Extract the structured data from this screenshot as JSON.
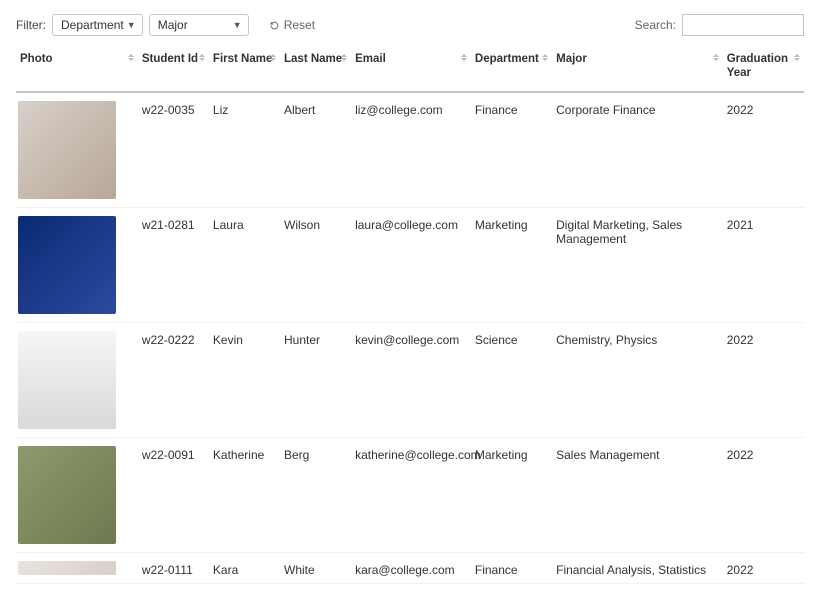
{
  "filters": {
    "label": "Filter:",
    "department": {
      "selected": "Department"
    },
    "major": {
      "selected": "Major"
    },
    "reset_label": "Reset"
  },
  "search": {
    "label": "Search:",
    "value": ""
  },
  "columns": {
    "photo": "Photo",
    "student_id": "Student Id",
    "first_name": "First Name",
    "last_name": "Last Name",
    "email": "Email",
    "department": "Department",
    "major": "Major",
    "grad_year": "Graduation Year"
  },
  "rows": [
    {
      "student_id": "w22-0035",
      "first_name": "Liz",
      "last_name": "Albert",
      "email": "liz@college.com",
      "department": "Finance",
      "major": "Corporate Finance",
      "grad_year": "2022"
    },
    {
      "student_id": "w21-0281",
      "first_name": "Laura",
      "last_name": "Wilson",
      "email": "laura@college.com",
      "department": "Marketing",
      "major": "Digital Marketing, Sales Management",
      "grad_year": "2021"
    },
    {
      "student_id": "w22-0222",
      "first_name": "Kevin",
      "last_name": "Hunter",
      "email": "kevin@college.com",
      "department": "Science",
      "major": "Chemistry, Physics",
      "grad_year": "2022"
    },
    {
      "student_id": "w22-0091",
      "first_name": "Katherine",
      "last_name": "Berg",
      "email": "katherine@college.com",
      "department": "Marketing",
      "major": "Sales Management",
      "grad_year": "2022"
    },
    {
      "student_id": "w22-0111",
      "first_name": "Kara",
      "last_name": "White",
      "email": "kara@college.com",
      "department": "Finance",
      "major": "Financial Analysis, Statistics",
      "grad_year": "2022"
    }
  ]
}
